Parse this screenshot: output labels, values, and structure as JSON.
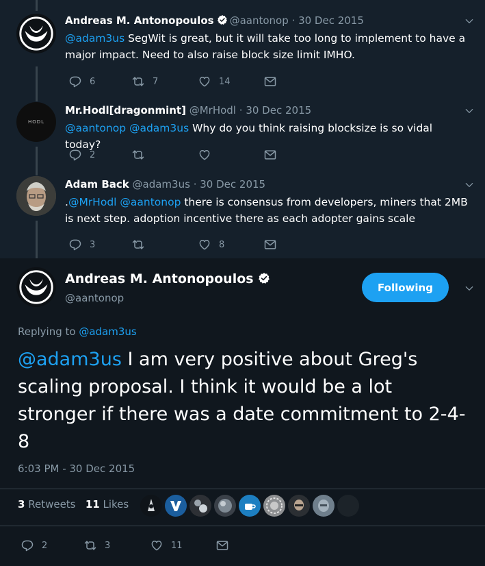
{
  "thread": [
    {
      "name": "Andreas M. Antonopoulos",
      "verified": true,
      "handle": "@aantonop",
      "separator": "·",
      "date": "30 Dec 2015",
      "mention": "@adam3us",
      "text": " SegWit is great, but it will take too long to implement to have a major impact. Need to also raise block size limit IMHO.",
      "replies": "6",
      "retweets": "7",
      "likes": "14"
    },
    {
      "name": "Mr.Hodl[dragonmint]",
      "handle": "@MrHodl",
      "separator": "·",
      "date": "30 Dec 2015",
      "avatar_text": "HODL",
      "mention": "@aantonop @adam3us",
      "text": " Why do you think raising blocksize is so vidal today?",
      "replies": "2",
      "retweets": "",
      "likes": ""
    },
    {
      "name": "Adam Back",
      "handle": "@adam3us",
      "separator": "·",
      "date": "30 Dec 2015",
      "prefix": ".",
      "mention": "@MrHodl @aantonop",
      "text": " there is consensus from developers, miners that 2MB is next step. adoption incentive there as each adopter gains scale",
      "replies": "3",
      "retweets": "",
      "likes": "8"
    }
  ],
  "focused": {
    "name": "Andreas M. Antonopoulos",
    "verified": true,
    "handle": "@aantonop",
    "follow_label": "Following",
    "replying_label": "Replying to ",
    "replying_to": "@adam3us",
    "mention": "@adam3us",
    "text": " I am very positive about Greg's scaling proposal. I think it would be a lot stronger if there was a date commitment to 2-4-8",
    "timestamp": "6:03 PM - 30 Dec 2015",
    "retweet_count": "3",
    "retweet_label": "Retweets",
    "like_count": "11",
    "like_label": "Likes",
    "replies": "2",
    "retweets": "3",
    "likes": "11"
  },
  "colors": {
    "background": "#10171e",
    "thread_background": "#15202b",
    "accent": "#1da1f2",
    "muted": "#8899a6"
  },
  "icons": [
    "reply-icon",
    "retweet-icon",
    "like-icon",
    "dm-icon",
    "verified-icon",
    "chevron-down-icon"
  ]
}
